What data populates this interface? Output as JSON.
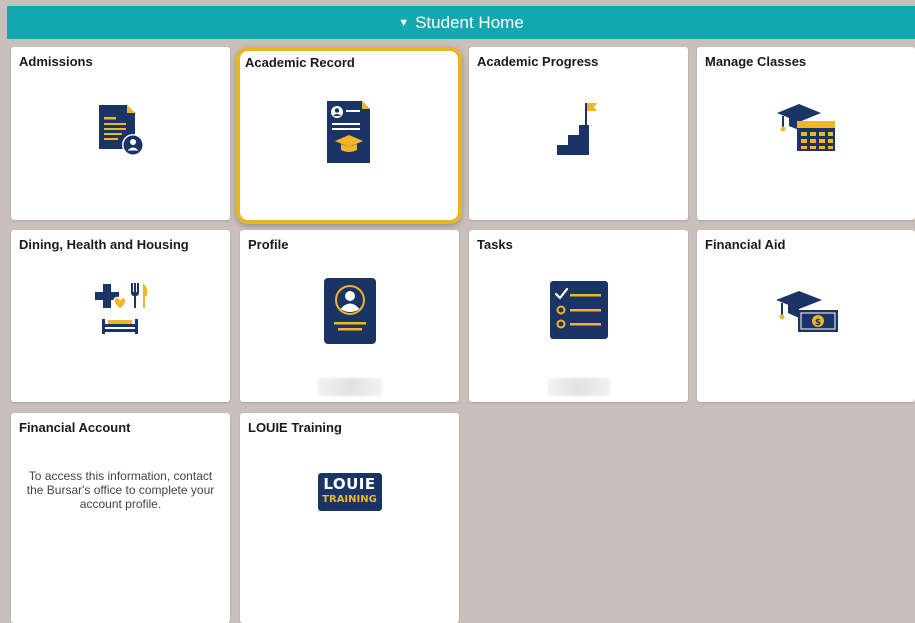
{
  "header": {
    "title": "Student Home",
    "toggle_icon": "triangle-down-icon"
  },
  "colors": {
    "header_bg": "#13a8b0",
    "navy": "#1a3466",
    "gold": "#f0b52a",
    "page_bg": "#c9bfbb"
  },
  "tiles": [
    {
      "title": "Admissions",
      "icon": "admissions-document-icon"
    },
    {
      "title": "Academic Record",
      "icon": "academic-record-icon"
    },
    {
      "title": "Academic Progress",
      "icon": "staircase-flag-icon"
    },
    {
      "title": "Manage Classes",
      "icon": "grad-cap-calendar-icon"
    },
    {
      "title": "Dining, Health and Housing",
      "icon": "health-dining-bed-icon"
    },
    {
      "title": "Profile",
      "icon": "profile-card-icon"
    },
    {
      "title": "Tasks",
      "icon": "task-checklist-icon"
    },
    {
      "title": "Financial Aid",
      "icon": "grad-cap-money-icon"
    },
    {
      "title": "Financial Account",
      "message": "To access this information, contact the Bursar's office to complete your account profile."
    },
    {
      "title": "LOUIE Training",
      "logo_line1": "LOUIE",
      "logo_line2": "TRAINING"
    }
  ]
}
